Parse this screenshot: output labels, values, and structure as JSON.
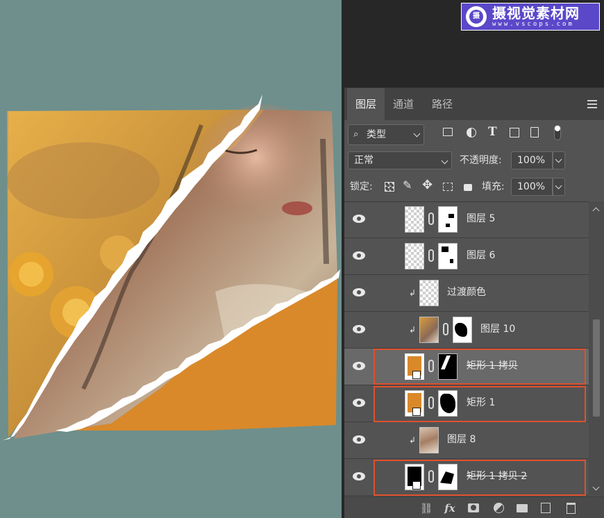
{
  "watermark": {
    "logo_glyph": "摄",
    "title": "摄视觉素材网",
    "url": "www.vscops.com"
  },
  "tabs": [
    {
      "label": "图层",
      "active": true
    },
    {
      "label": "通道",
      "active": false
    },
    {
      "label": "路径",
      "active": false
    }
  ],
  "filter": {
    "kind_label": "类型",
    "icons": [
      "image-filter-icon",
      "adjustment-filter-icon",
      "type-filter-icon",
      "shape-filter-icon",
      "smart-object-filter-icon",
      "filter-toggle-icon"
    ]
  },
  "blend": {
    "mode": "正常",
    "opacity_label": "不透明度:",
    "opacity_value": "100%"
  },
  "lock": {
    "label": "锁定:",
    "fill_label": "填充:",
    "fill_value": "100%"
  },
  "layers": [
    {
      "name": "图层 5",
      "thumb": "checker",
      "mask": true,
      "clipped": false,
      "strike": false,
      "selected": false,
      "highlighted": false
    },
    {
      "name": "图层 6",
      "thumb": "checker",
      "mask": true,
      "clipped": false,
      "strike": false,
      "selected": false,
      "highlighted": false
    },
    {
      "name": "过渡颜色",
      "thumb": "checker",
      "mask": false,
      "clipped": true,
      "strike": false,
      "selected": false,
      "highlighted": false
    },
    {
      "name": "图层 10",
      "thumb": "photo",
      "mask": true,
      "clipped": true,
      "strike": false,
      "selected": false,
      "highlighted": false
    },
    {
      "name": "矩形 1 拷贝",
      "thumb": "orange-shape",
      "mask": true,
      "clipped": false,
      "strike": true,
      "selected": true,
      "highlighted": true
    },
    {
      "name": "矩形 1",
      "thumb": "orange-shape",
      "mask": true,
      "clipped": false,
      "strike": false,
      "selected": false,
      "highlighted": true
    },
    {
      "name": "图层 8",
      "thumb": "photo",
      "mask": false,
      "clipped": true,
      "strike": false,
      "selected": false,
      "highlighted": false
    },
    {
      "name": "矩形 1 拷贝 2",
      "thumb": "black-shape",
      "mask": true,
      "clipped": false,
      "strike": true,
      "selected": false,
      "highlighted": true
    }
  ],
  "colors": {
    "canvas_bg": "#6e8f8c",
    "panel_bg": "#535353",
    "highlight": "#e0502c",
    "orange": "#d9892a"
  },
  "bottom_icons": [
    "link-layers-icon",
    "fx-icon",
    "add-mask-icon",
    "adjustment-layer-icon",
    "new-group-icon",
    "new-layer-icon",
    "delete-layer-icon"
  ]
}
